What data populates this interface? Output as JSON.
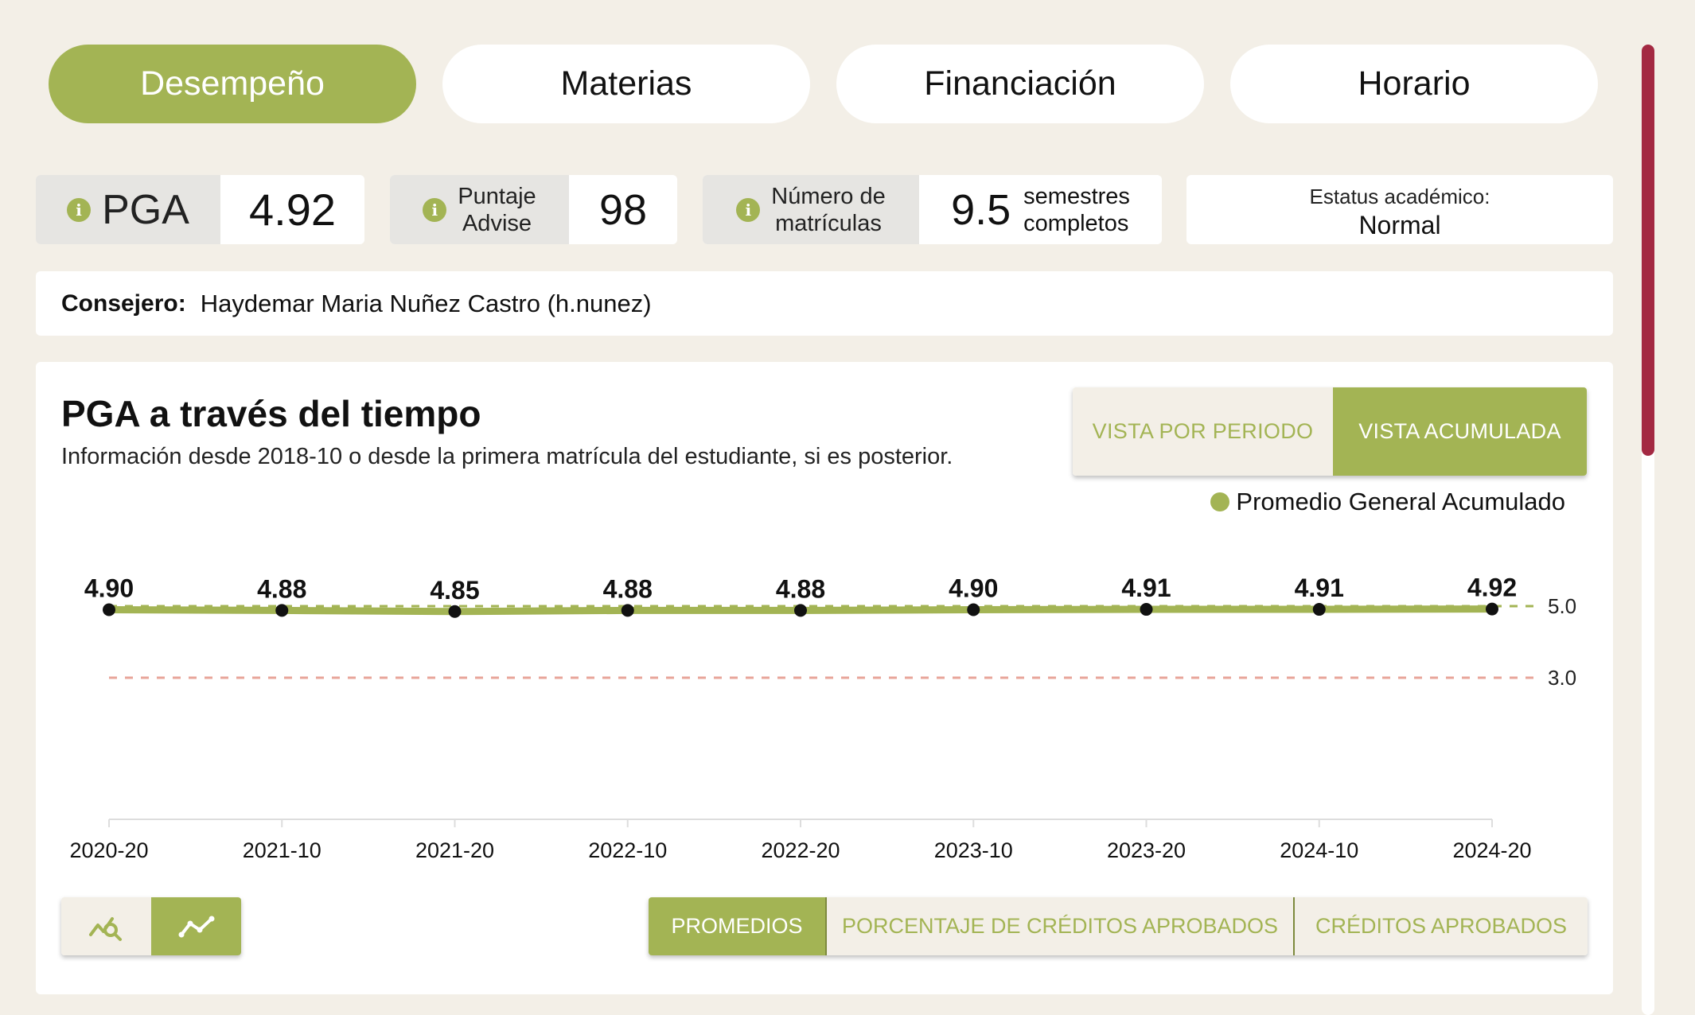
{
  "tabs": [
    {
      "label": "Desempeño",
      "active": true
    },
    {
      "label": "Materias",
      "active": false
    },
    {
      "label": "Financiación",
      "active": false
    },
    {
      "label": "Horario",
      "active": false
    }
  ],
  "stats": {
    "pga": {
      "label": "PGA",
      "value": "4.92"
    },
    "advise": {
      "label_line1": "Puntaje",
      "label_line2": "Advise",
      "value": "98"
    },
    "matriculas": {
      "label_line1": "Número de",
      "label_line2": "matrículas",
      "value": "9.5",
      "unit_line1": "semestres",
      "unit_line2": "completos"
    },
    "estatus": {
      "label": "Estatus académico:",
      "value": "Normal"
    }
  },
  "advisor": {
    "label": "Consejero:",
    "name": "Haydemar Maria Nuñez Castro (h.nunez)"
  },
  "chart_section": {
    "title": "PGA a través del tiempo",
    "subtitle": "Información desde 2018-10 o desde la primera matrícula del estudiante, si es posterior.",
    "view_buttons": [
      {
        "label": "VISTA POR PERIODO",
        "active": false
      },
      {
        "label": "VISTA ACUMULADA",
        "active": true
      }
    ],
    "metric_buttons": [
      {
        "label": "PROMEDIOS",
        "active": true
      },
      {
        "label": "PORCENTAJE DE CRÉDITOS APROBADOS",
        "active": false
      },
      {
        "label": "CRÉDITOS APROBADOS",
        "active": false
      }
    ],
    "icon_buttons": [
      {
        "icon": "chart-zoom-icon",
        "active": false
      },
      {
        "icon": "line-chart-icon",
        "active": true
      }
    ]
  },
  "colors": {
    "accent": "#a3b454",
    "scrollbar": "#a32942",
    "target_line": "#a3b454",
    "min_line": "#e8a59a"
  },
  "chart_data": {
    "type": "line",
    "categories": [
      "2020-20",
      "2021-10",
      "2021-20",
      "2022-10",
      "2022-20",
      "2023-10",
      "2023-20",
      "2024-10",
      "2024-20"
    ],
    "series": [
      {
        "name": "Promedio General Acumulado",
        "values": [
          4.9,
          4.88,
          4.85,
          4.88,
          4.88,
          4.9,
          4.91,
          4.91,
          4.92
        ]
      }
    ],
    "data_labels": [
      "4.90",
      "4.88",
      "4.85",
      "4.88",
      "4.88",
      "4.90",
      "4.91",
      "4.91",
      "4.92"
    ],
    "reference_lines": [
      {
        "value": 5.0,
        "label": "5.0",
        "color": "#a3b454"
      },
      {
        "value": 3.0,
        "label": "3.0",
        "color": "#e8a59a"
      }
    ],
    "ylim": [
      0,
      5.0
    ],
    "legend_position": "top-right",
    "grid": false
  }
}
